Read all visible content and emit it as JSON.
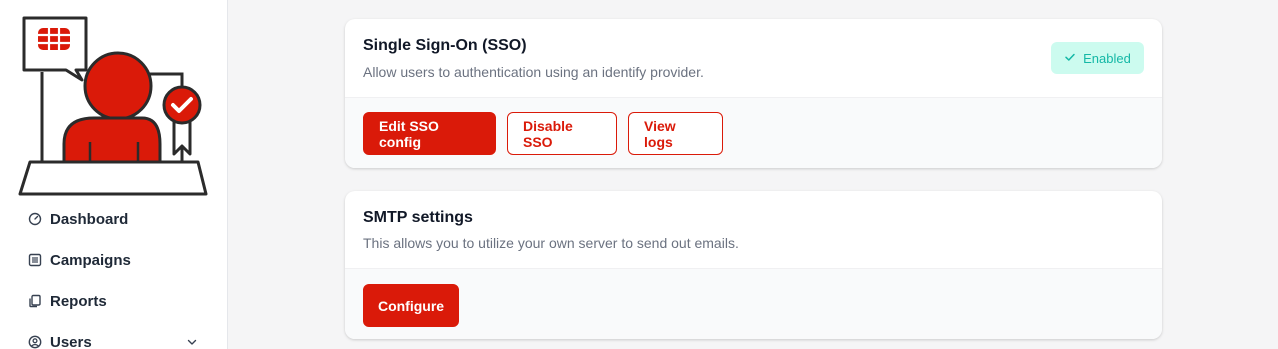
{
  "colors": {
    "brand": "#da1a09",
    "badge_bg": "#ccfbef",
    "badge_text": "#14b8a6"
  },
  "sidebar": {
    "logo_icon": "user-certificate-logo-icon",
    "items": [
      {
        "label": "Dashboard",
        "icon": "gauge-icon"
      },
      {
        "label": "Campaigns",
        "icon": "columns-icon"
      },
      {
        "label": "Reports",
        "icon": "copy-icon"
      },
      {
        "label": "Users",
        "icon": "user-circle-icon",
        "has_submenu": true
      }
    ]
  },
  "sso": {
    "title": "Single Sign-On (SSO)",
    "description": "Allow users to authentication using an identify provider.",
    "status": "Enabled",
    "buttons": {
      "edit": "Edit SSO config",
      "disable": "Disable SSO",
      "logs": "View logs"
    }
  },
  "smtp": {
    "title": "SMTP settings",
    "description": "This allows you to utilize your own server to send out emails.",
    "buttons": {
      "configure": "Configure"
    }
  }
}
